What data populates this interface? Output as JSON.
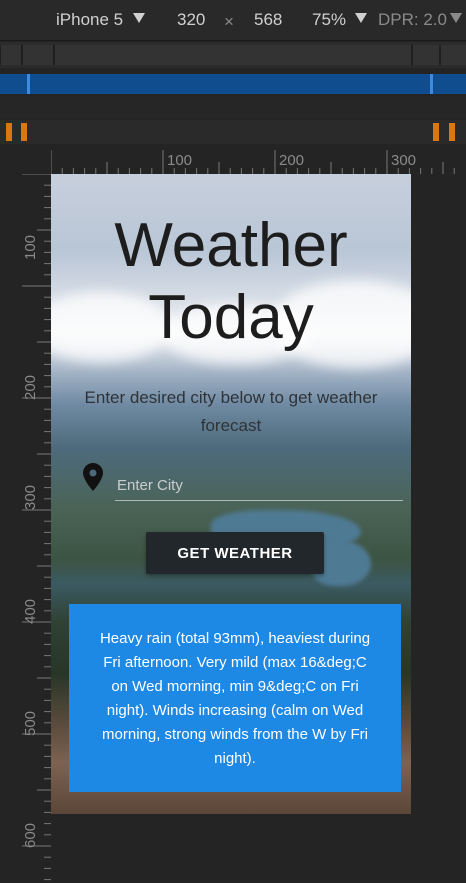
{
  "toolbar": {
    "device": "iPhone 5",
    "width": "320",
    "times": "×",
    "height": "568",
    "zoom": "75%",
    "dpr": "DPR: 2.0"
  },
  "rulers": {
    "horizontal": [
      "100",
      "200",
      "300"
    ],
    "vertical": [
      "100",
      "200",
      "300",
      "400",
      "500",
      "600"
    ]
  },
  "page": {
    "title_line1": "Weather",
    "title_line2": "Today",
    "subtitle": "Enter desired city below to get weather forecast",
    "city_placeholder": "Enter City",
    "city_value": "",
    "button_label": "GET WEATHER",
    "forecast_text": "Heavy rain (total 93mm), heaviest during Fri afternoon. Very mild (max 16&deg;C on Wed morning, min 9&deg;C on Fri night). Winds increasing (calm on Wed morning, strong winds from the W by Fri night)."
  },
  "colors": {
    "background": "#242424",
    "accent_blue": "#1e88e5",
    "media_query_blue": "#0f4d8e",
    "orange": "#d9780f",
    "button_dark": "#22272b"
  },
  "icons": {
    "dropdown": "triangle-down-icon",
    "pin": "map-pin-icon"
  }
}
